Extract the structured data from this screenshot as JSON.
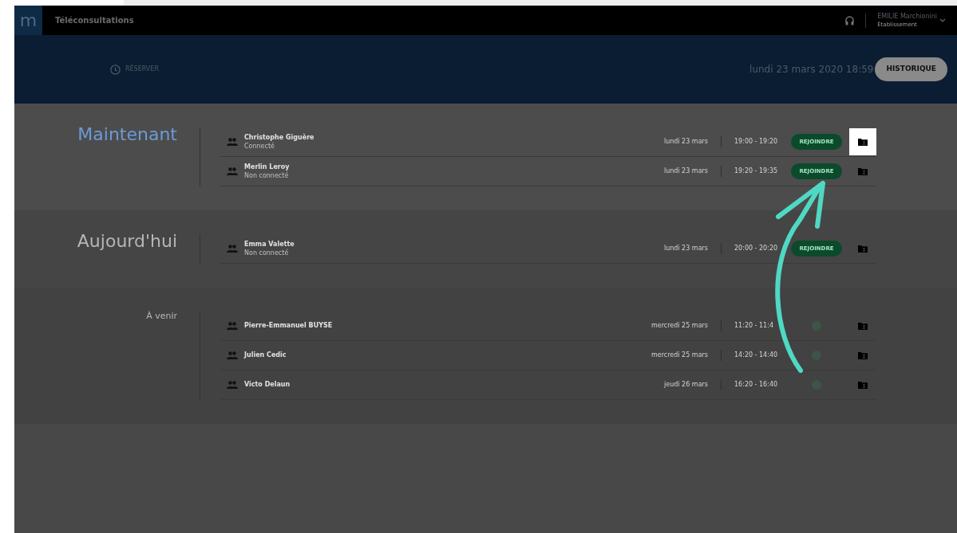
{
  "topbar": {
    "logo": "m",
    "title": "Téléconsultations",
    "user_name": "EMILIE Marchionini",
    "user_role": "Établissement"
  },
  "banner": {
    "reserve": "RÉSERVER",
    "datetime": "lundi 23 mars 2020 18:59",
    "history": "HISTORIQUE"
  },
  "sections": [
    {
      "heading": "Maintenant",
      "kind": "large",
      "current": true,
      "rows": [
        {
          "name": "Christophe Giguère",
          "status": "Connecté",
          "date": "lundi 23 mars",
          "time": "19:00 - 19:20",
          "join": "REJOINDRE",
          "joinable": true,
          "highlighted": true
        },
        {
          "name": "Merlin Leroy",
          "status": "Non connecté",
          "date": "lundi 23 mars",
          "time": "19:20 - 19:35",
          "join": "REJOINDRE",
          "joinable": true,
          "highlighted": false
        }
      ]
    },
    {
      "heading": "Aujourd'hui",
      "kind": "large",
      "current": false,
      "rows": [
        {
          "name": "Emma Valette",
          "status": "Non connecté",
          "date": "lundi 23 mars",
          "time": "20:00 - 20:20",
          "join": "REJOINDRE",
          "joinable": true,
          "highlighted": false
        }
      ]
    },
    {
      "heading": "À venir",
      "kind": "small",
      "current": false,
      "rows": [
        {
          "name": "Pierre-Emmanuel BUYSE",
          "date": "mercredi 25 mars",
          "time": "11:20 - 11:4",
          "joinable": false,
          "highlighted": false
        },
        {
          "name": "Julien Cedic",
          "date": "mercredi 25 mars",
          "time": "14:20 - 14:40",
          "joinable": false,
          "highlighted": false
        },
        {
          "name": "Victo Delaun",
          "date": "jeudi 26 mars",
          "time": "16:20 - 16:40",
          "joinable": false,
          "highlighted": false
        }
      ]
    }
  ]
}
